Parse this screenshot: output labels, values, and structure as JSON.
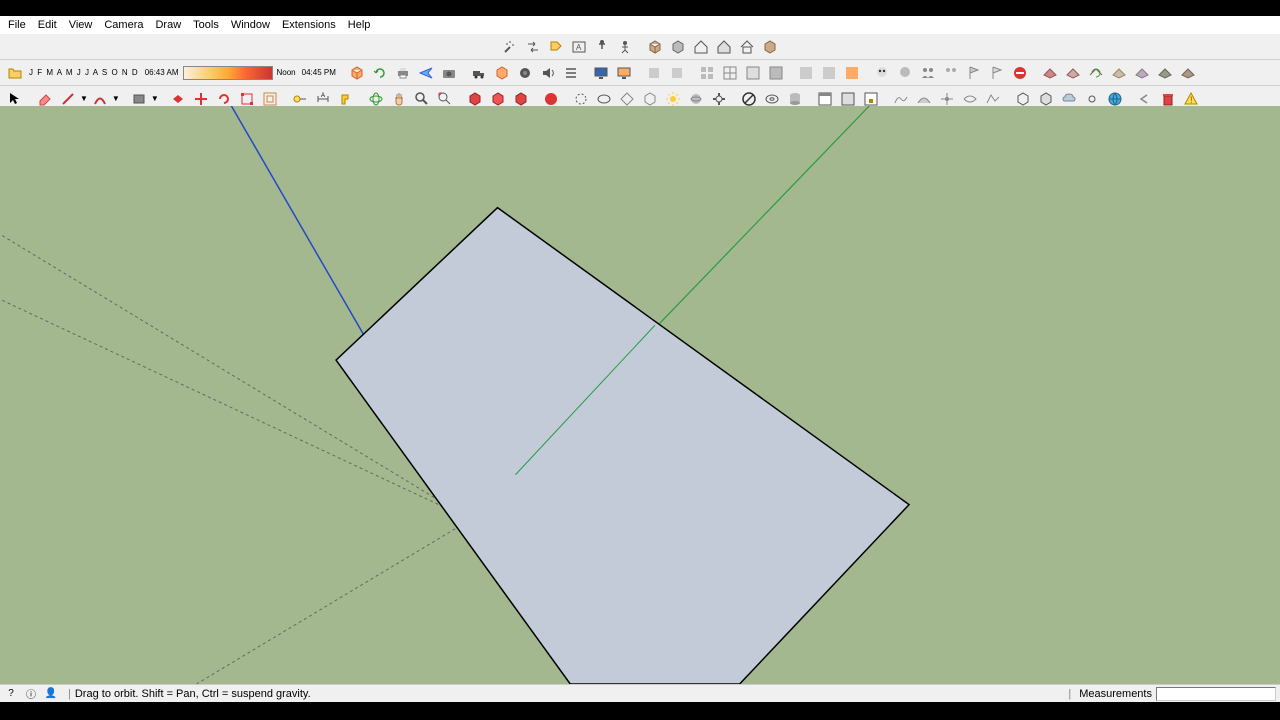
{
  "menu": {
    "file": "File",
    "edit": "Edit",
    "view": "View",
    "camera": "Camera",
    "draw": "Draw",
    "tools": "Tools",
    "window": "Window",
    "extensions": "Extensions",
    "help": "Help"
  },
  "shadows": {
    "months": "J F M A M J J A S O N D",
    "time_start": "06:43 AM",
    "noon": "Noon",
    "time_end": "04:45 PM"
  },
  "status": {
    "hint": "Drag to orbit. Shift = Pan, Ctrl = suspend gravity.",
    "measurements_label": "Measurements"
  }
}
